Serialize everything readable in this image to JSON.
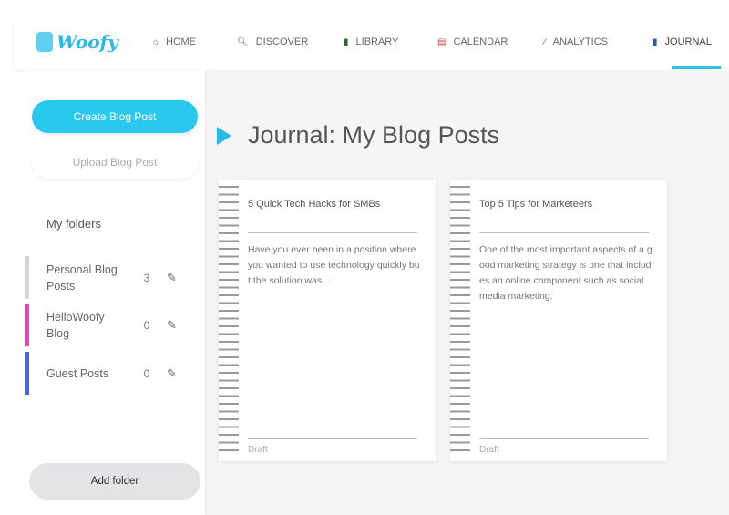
{
  "brand": {
    "name": "Woofy"
  },
  "nav": [
    {
      "label": "HOME",
      "icon": "home-icon"
    },
    {
      "label": "DISCOVER",
      "icon": "search-icon"
    },
    {
      "label": "LIBRARY",
      "icon": "books-icon"
    },
    {
      "label": "CALENDAR",
      "icon": "calendar-icon"
    },
    {
      "label": "ANALYTICS",
      "icon": "analytics-icon"
    },
    {
      "label": "JOURNAL",
      "icon": "journal-icon",
      "active": true
    }
  ],
  "sidebar": {
    "create_label": "Create Blog Post",
    "upload_label": "Upload Blog Post",
    "folders_heading": "My folders",
    "folders": [
      {
        "name": "Personal Blog Posts",
        "count": "3",
        "color": "#d6d6d6"
      },
      {
        "name": "HelloWoofy Blog",
        "count": "0",
        "color": "#f03fc9"
      },
      {
        "name": "Guest Posts",
        "count": "0",
        "color": "#3d63f2"
      }
    ],
    "add_folder_label": "Add folder"
  },
  "main": {
    "title": "Journal: My Blog Posts",
    "posts": [
      {
        "title": "5 Quick Tech Hacks for SMBs",
        "excerpt": "Have you ever been in a position where you wanted to use technology quickly but the solution was...",
        "status": "Draft"
      },
      {
        "title": "Top 5 Tips for Marketeers",
        "excerpt": "One of the most important aspects of a good marketing strategy is one that includes an online component such as social media marketing.",
        "status": "Draft"
      }
    ]
  },
  "colors": {
    "accent": "#29c9ef"
  }
}
